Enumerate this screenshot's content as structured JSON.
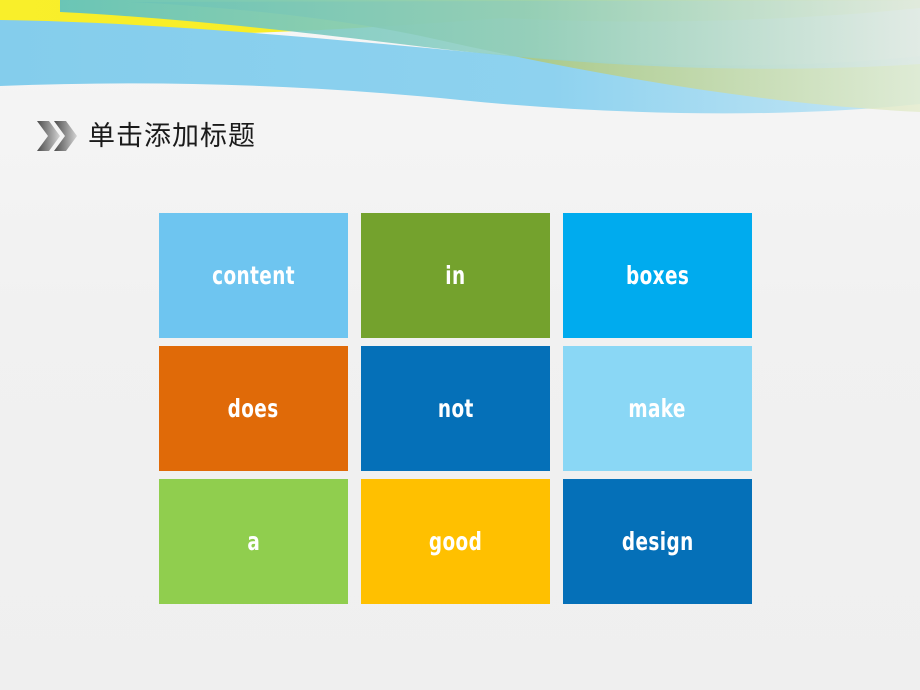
{
  "slide": {
    "background_color": "#f1f1f1",
    "title": "单击添加标题",
    "title_icon": "double-chevron-right-icon"
  },
  "banner": {
    "colors": {
      "yellow": "#f7ec21",
      "light_blue": "#85cdec",
      "pale_blue": "#a9dcf2",
      "teal": "#6cc5c0",
      "olive_green": "#9cbb5e",
      "pale_green": "#cddfab"
    }
  },
  "grid": {
    "columns": 3,
    "rows": 3,
    "tiles": [
      {
        "label": "content",
        "color": "#6ec5f0"
      },
      {
        "label": "in",
        "color": "#74a22d"
      },
      {
        "label": "boxes",
        "color": "#00abee"
      },
      {
        "label": "does",
        "color": "#e06a08"
      },
      {
        "label": "not",
        "color": "#0570b8"
      },
      {
        "label": "make",
        "color": "#8ad7f5"
      },
      {
        "label": "a",
        "color": "#90ce4e"
      },
      {
        "label": "good",
        "color": "#ffc000"
      },
      {
        "label": "design",
        "color": "#0570b8"
      }
    ]
  }
}
